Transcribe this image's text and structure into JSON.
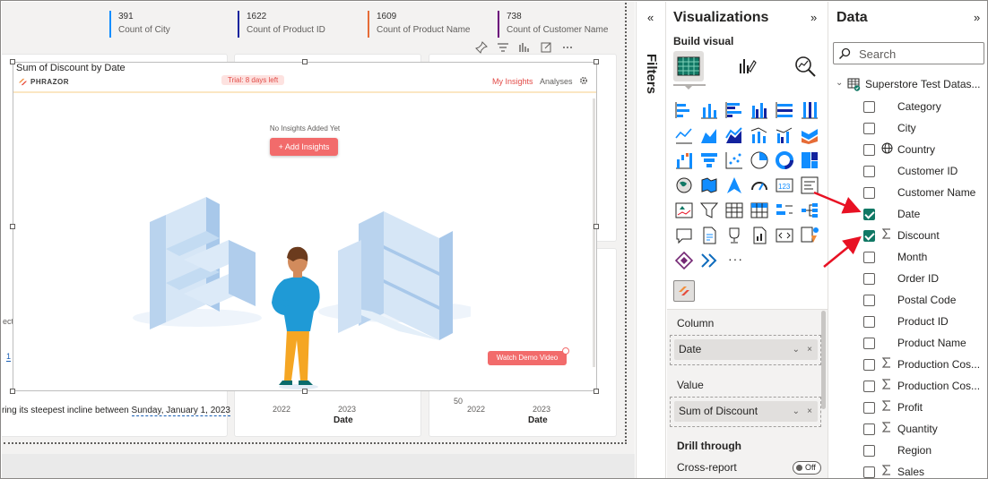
{
  "kpis": [
    {
      "value": "391",
      "label": "Count of City",
      "color": "#118dff"
    },
    {
      "value": "1622",
      "label": "Count of Product ID",
      "color": "#12239e"
    },
    {
      "value": "1609",
      "label": "Count of Product Name",
      "color": "#e66c37"
    },
    {
      "value": "738",
      "label": "Count of Customer Name",
      "color": "#6b007b"
    }
  ],
  "background_cards": {
    "left_fragment_text": "ring its steepest incline between",
    "left_fragment_link": "Sunday, January 1, 2023",
    "left_stub": "ect",
    "left_axis_one": "1",
    "middle_ticks": [
      "2022",
      "2023"
    ],
    "middle_axis_title": "Date",
    "right_tick_value": "50",
    "right_ticks": [
      "2022",
      "2023"
    ],
    "right_axis_title": "Date"
  },
  "visual": {
    "title": "Sum of Discount by Date",
    "brand": "PHRAZOR",
    "trial_badge": "Trial: 8 days left",
    "my_insights": "My Insights",
    "analyses": "Analyses",
    "empty_text": "No Insights Added Yet",
    "add_button": "+ Add Insights",
    "demo_button": "Watch Demo Video"
  },
  "filters": {
    "label": "Filters",
    "collapse_glyph": "«"
  },
  "visualizations": {
    "title": "Visualizations",
    "expand_glyph": "»",
    "build_visual": "Build visual",
    "more_glyph": "···",
    "column_label": "Column",
    "column_field": "Date",
    "value_label": "Value",
    "value_field": "Sum of Discount",
    "chevron": "⌄",
    "remove": "×",
    "drill_through": "Drill through",
    "cross_report": "Cross-report",
    "toggle_state": "Off"
  },
  "data": {
    "title": "Data",
    "expand_glyph": "»",
    "search_placeholder": "Search",
    "table_name": "Superstore Test Datas...",
    "fields": [
      {
        "name": "Category",
        "checked": false,
        "icon": ""
      },
      {
        "name": "City",
        "checked": false,
        "icon": ""
      },
      {
        "name": "Country",
        "checked": false,
        "icon": "globe-icon"
      },
      {
        "name": "Customer ID",
        "checked": false,
        "icon": ""
      },
      {
        "name": "Customer Name",
        "checked": false,
        "icon": ""
      },
      {
        "name": "Date",
        "checked": true,
        "icon": ""
      },
      {
        "name": "Discount",
        "checked": true,
        "icon": "sigma-icon"
      },
      {
        "name": "Month",
        "checked": false,
        "icon": ""
      },
      {
        "name": "Order ID",
        "checked": false,
        "icon": ""
      },
      {
        "name": "Postal Code",
        "checked": false,
        "icon": ""
      },
      {
        "name": "Product ID",
        "checked": false,
        "icon": ""
      },
      {
        "name": "Product Name",
        "checked": false,
        "icon": ""
      },
      {
        "name": "Production Cos...",
        "checked": false,
        "icon": "sigma-icon"
      },
      {
        "name": "Production Cos...",
        "checked": false,
        "icon": "sigma-icon"
      },
      {
        "name": "Profit",
        "checked": false,
        "icon": "sigma-icon"
      },
      {
        "name": "Quantity",
        "checked": false,
        "icon": "sigma-icon"
      },
      {
        "name": "Region",
        "checked": false,
        "icon": ""
      },
      {
        "name": "Sales",
        "checked": false,
        "icon": "sigma-icon"
      }
    ]
  },
  "colors": {
    "accent_green": "#117865",
    "phrazor_red": "#f26b6b",
    "arrow_red": "#e81123"
  }
}
